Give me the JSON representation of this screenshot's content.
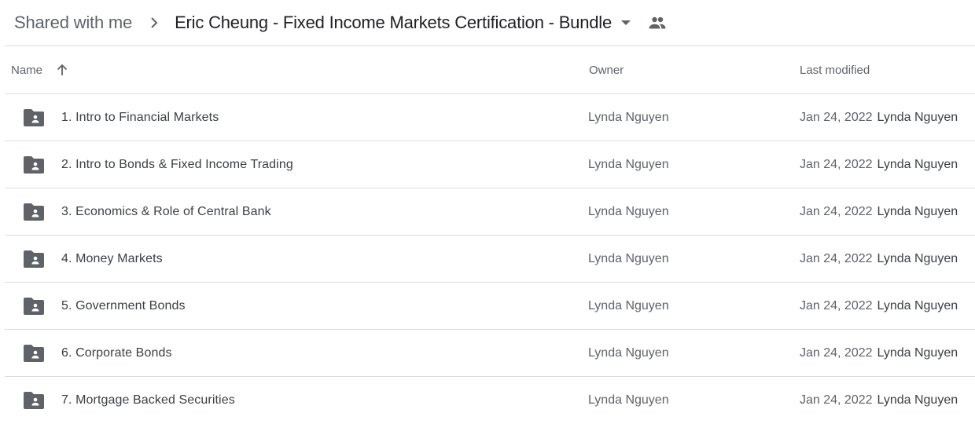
{
  "breadcrumb": {
    "root": "Shared with me",
    "current": "Eric Cheung - Fixed Income Markets Certification - Bundle",
    "icons": {
      "separator": "chevron-right-icon",
      "dropdown": "caret-down-icon",
      "shared": "people-icon"
    }
  },
  "table": {
    "columns": {
      "name": "Name",
      "owner": "Owner",
      "last_modified": "Last modified"
    },
    "sort": {
      "column": "name",
      "direction": "ascending",
      "icon": "arrow-up-icon"
    },
    "rows": [
      {
        "name": "1. Intro to Financial Markets",
        "owner": "Lynda Nguyen",
        "modified_date": "Jan 24, 2022",
        "modified_by": "Lynda Nguyen",
        "icon": "shared-folder-icon"
      },
      {
        "name": "2. Intro to Bonds & Fixed Income Trading",
        "owner": "Lynda Nguyen",
        "modified_date": "Jan 24, 2022",
        "modified_by": "Lynda Nguyen",
        "icon": "shared-folder-icon"
      },
      {
        "name": "3. Economics & Role of Central Bank",
        "owner": "Lynda Nguyen",
        "modified_date": "Jan 24, 2022",
        "modified_by": "Lynda Nguyen",
        "icon": "shared-folder-icon"
      },
      {
        "name": "4. Money Markets",
        "owner": "Lynda Nguyen",
        "modified_date": "Jan 24, 2022",
        "modified_by": "Lynda Nguyen",
        "icon": "shared-folder-icon"
      },
      {
        "name": "5. Government Bonds",
        "owner": "Lynda Nguyen",
        "modified_date": "Jan 24, 2022",
        "modified_by": "Lynda Nguyen",
        "icon": "shared-folder-icon"
      },
      {
        "name": "6. Corporate Bonds",
        "owner": "Lynda Nguyen",
        "modified_date": "Jan 24, 2022",
        "modified_by": "Lynda Nguyen",
        "icon": "shared-folder-icon"
      },
      {
        "name": "7. Mortgage Backed Securities",
        "owner": "Lynda Nguyen",
        "modified_date": "Jan 24, 2022",
        "modified_by": "Lynda Nguyen",
        "icon": "shared-folder-icon"
      }
    ]
  },
  "colors": {
    "icon": "#5f6368",
    "divider": "#dadce0",
    "text_primary": "#3c4043",
    "text_secondary": "#5f6368"
  }
}
